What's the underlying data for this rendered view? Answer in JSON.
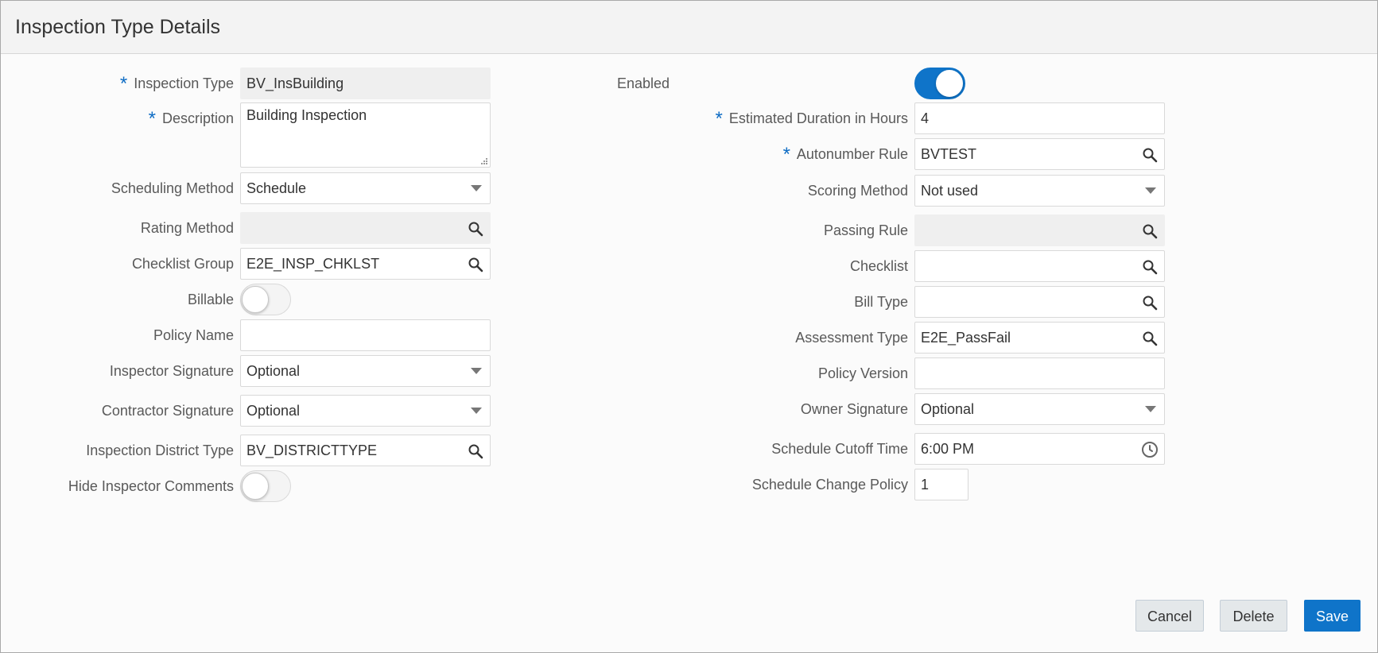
{
  "dialog": {
    "title": "Inspection Type Details"
  },
  "left": {
    "inspection_type": {
      "label": "Inspection Type",
      "value": "BV_InsBuilding"
    },
    "description": {
      "label": "Description",
      "value": "Building Inspection"
    },
    "scheduling_method": {
      "label": "Scheduling Method",
      "value": "Schedule"
    },
    "rating_method": {
      "label": "Rating Method",
      "value": ""
    },
    "checklist_group": {
      "label": "Checklist Group",
      "value": "E2E_INSP_CHKLST"
    },
    "billable": {
      "label": "Billable",
      "on": false
    },
    "policy_name": {
      "label": "Policy Name",
      "value": ""
    },
    "inspector_signature": {
      "label": "Inspector Signature",
      "value": "Optional"
    },
    "contractor_signature": {
      "label": "Contractor Signature",
      "value": "Optional"
    },
    "inspection_district_type": {
      "label": "Inspection District Type",
      "value": "BV_DISTRICTTYPE"
    },
    "hide_inspector_comments": {
      "label": "Hide Inspector Comments",
      "on": false
    }
  },
  "right": {
    "enabled": {
      "label": "Enabled",
      "on": true
    },
    "estimated_duration": {
      "label": "Estimated Duration in Hours",
      "value": "4"
    },
    "autonumber_rule": {
      "label": "Autonumber Rule",
      "value": "BVTEST"
    },
    "scoring_method": {
      "label": "Scoring Method",
      "value": "Not used"
    },
    "passing_rule": {
      "label": "Passing Rule",
      "value": ""
    },
    "checklist": {
      "label": "Checklist",
      "value": ""
    },
    "bill_type": {
      "label": "Bill Type",
      "value": ""
    },
    "assessment_type": {
      "label": "Assessment Type",
      "value": "E2E_PassFail"
    },
    "policy_version": {
      "label": "Policy Version",
      "value": ""
    },
    "owner_signature": {
      "label": "Owner Signature",
      "value": "Optional"
    },
    "schedule_cutoff_time": {
      "label": "Schedule Cutoff Time",
      "value": "6:00 PM"
    },
    "schedule_change_policy": {
      "label": "Schedule Change Policy",
      "value": "1"
    }
  },
  "required_marker": "*",
  "buttons": {
    "cancel": "Cancel",
    "delete": "Delete",
    "save": "Save"
  },
  "icons": {
    "search": "search-icon",
    "clock": "clock-icon",
    "dropdown": "chevron-down-icon",
    "resize": "resize-handle-icon"
  },
  "colors": {
    "accent": "#0f74c9",
    "required": "#0e6cc4",
    "readonly_bg": "#efefef"
  }
}
